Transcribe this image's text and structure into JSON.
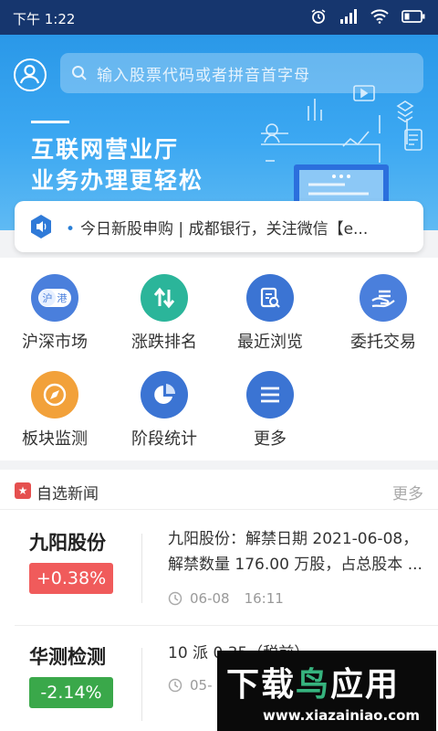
{
  "status_bar": {
    "time": "下午 1:22"
  },
  "search": {
    "placeholder": "输入股票代码或者拼音首字母"
  },
  "banner": {
    "line1": "互联网营业厅",
    "line2": "业务办理更轻松"
  },
  "notice": {
    "text": "今日新股申购 | 成都银行，关注微信【e..."
  },
  "menu": {
    "items": [
      {
        "label": "沪深市场",
        "icon": "hu-shen-icon",
        "color": "#4a7fdc",
        "sub1": "沪",
        "sub2": "港"
      },
      {
        "label": "涨跌排名",
        "icon": "up-down-arrows-icon",
        "color": "#2bb59a"
      },
      {
        "label": "最近浏览",
        "icon": "search-document-icon",
        "color": "#3b74d3"
      },
      {
        "label": "委托交易",
        "icon": "hand-trade-icon",
        "color": "#4a7fdc"
      },
      {
        "label": "板块监测",
        "icon": "compass-icon",
        "color": "#f2a13a"
      },
      {
        "label": "阶段统计",
        "icon": "pie-chart-icon",
        "color": "#3b74d3"
      },
      {
        "label": "更多",
        "icon": "menu-lines-icon",
        "color": "#3b74d3"
      }
    ]
  },
  "news": {
    "header": "自选新闻",
    "more": "更多",
    "rows": [
      {
        "stock": "九阳股份",
        "change": "+0.38%",
        "change_color": "#f05b5b",
        "text": "九阳股份：解禁日期 2021-06-08，解禁数量 176.00 万股，占总股本 ...",
        "date": "06-08",
        "time": "16:11"
      },
      {
        "stock": "华测检测",
        "change": "-2.14%",
        "change_color": "#3aa84a",
        "text": "10 派 0.35（税前）",
        "date": "05-"
      }
    ]
  },
  "watermark": {
    "title_a": "下载",
    "title_b": "鸟",
    "title_c": "应用",
    "url": "www.xiazainiao.com"
  }
}
